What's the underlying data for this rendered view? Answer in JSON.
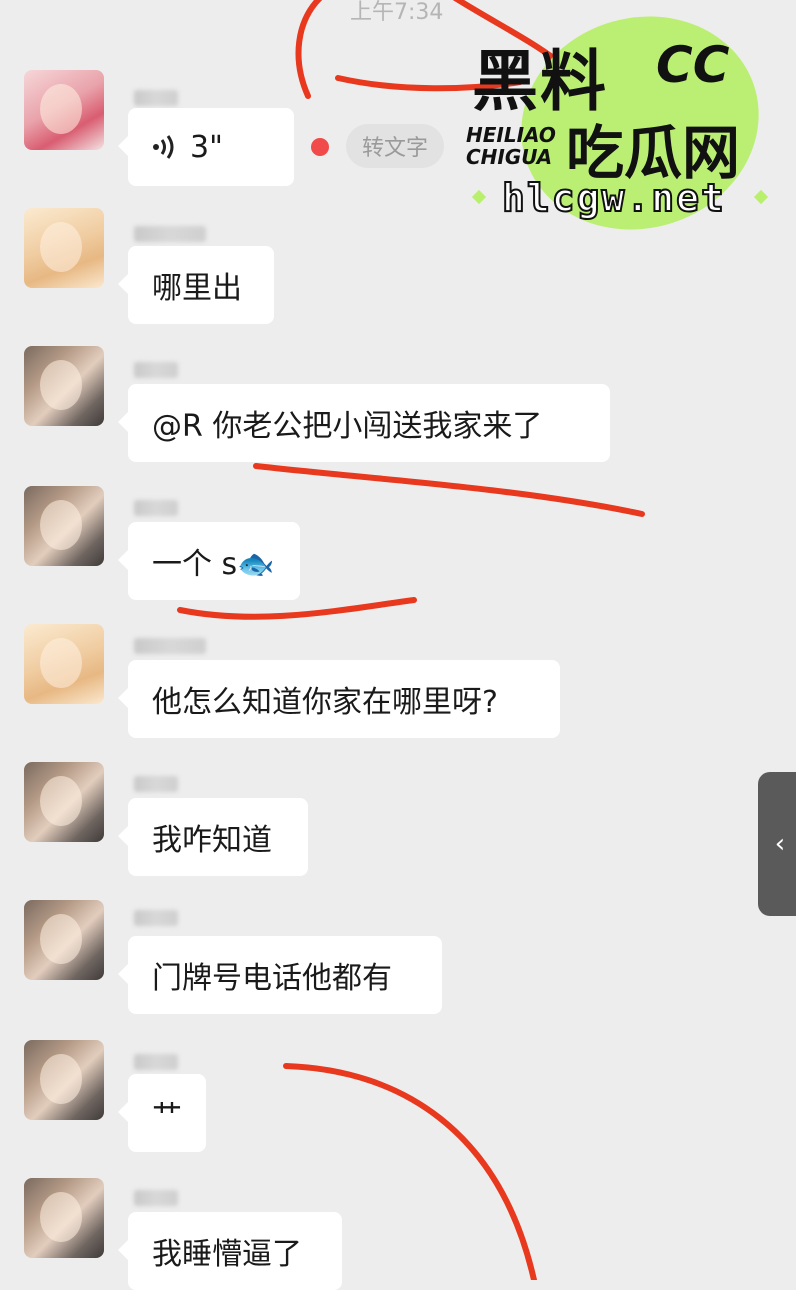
{
  "status": {
    "time": "上午7:34"
  },
  "voice_message": {
    "duration": "3\"",
    "to_text_label": "转文字"
  },
  "messages": [
    {
      "text": "哪里出"
    },
    {
      "text": "@R  你老公把小闯送我家来了"
    },
    {
      "text": "一个 s🐟"
    },
    {
      "text": "他怎么知道你家在哪里呀?"
    },
    {
      "text": "我咋知道"
    },
    {
      "text": "门牌号电话他都有"
    },
    {
      "text": "艹"
    },
    {
      "text": "我睡懵逼了"
    }
  ],
  "side_handle": {
    "icon": "chevron-left-icon",
    "glyph": "‹"
  },
  "watermark": {
    "title": "黑料",
    "cc": "CC",
    "latin_line1": "HEILIAO",
    "latin_line2": "CHIGUA",
    "subtitle": "吃瓜网",
    "url": "hlcgw.net",
    "accent_color": "#b8ef6d"
  },
  "colors": {
    "background": "#ededed",
    "bubble": "#ffffff",
    "annotation": "#e8391e"
  }
}
